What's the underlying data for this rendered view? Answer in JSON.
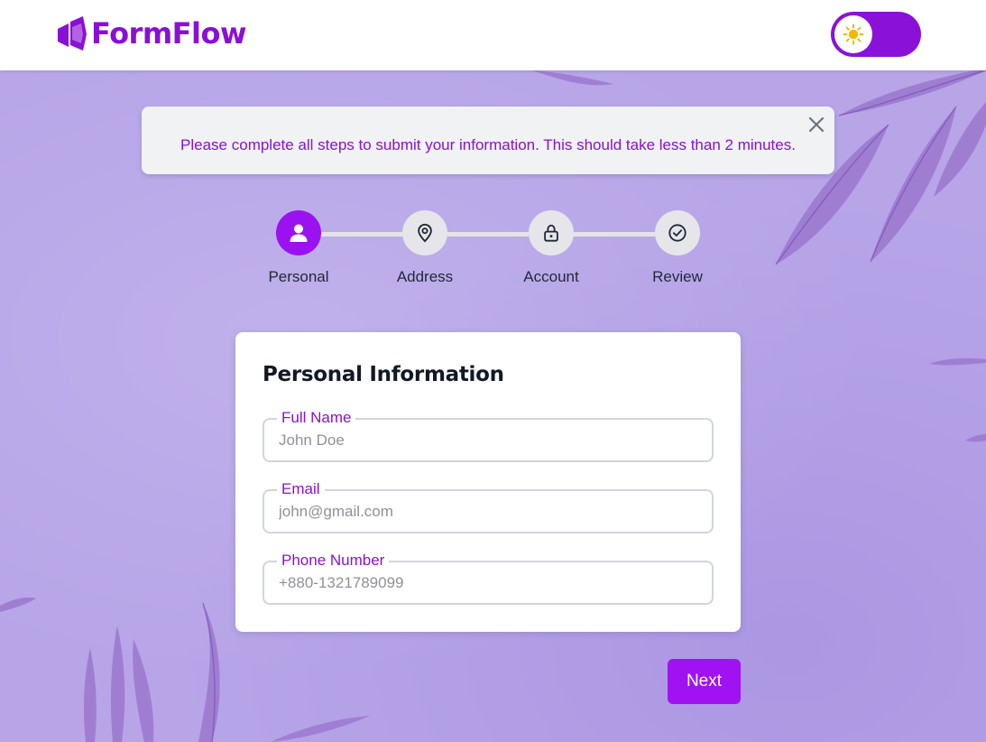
{
  "header": {
    "brand": "FormFlow",
    "theme_toggle": {
      "mode": "light",
      "icon": "sun-icon"
    }
  },
  "alert": {
    "message": "Please complete all steps to submit your information. This should take less than 2 minutes.",
    "close_icon": "close-icon"
  },
  "stepper": {
    "active_index": 0,
    "steps": [
      {
        "label": "Personal",
        "icon": "user-icon"
      },
      {
        "label": "Address",
        "icon": "map-pin-icon"
      },
      {
        "label": "Account",
        "icon": "lock-icon"
      },
      {
        "label": "Review",
        "icon": "check-circle-icon"
      }
    ]
  },
  "form": {
    "title": "Personal Information",
    "fields": [
      {
        "label": "Full Name",
        "placeholder": "John Doe",
        "value": ""
      },
      {
        "label": "Email",
        "placeholder": "john@gmail.com",
        "value": ""
      },
      {
        "label": "Phone Number",
        "placeholder": "+880-1321789099",
        "value": ""
      }
    ]
  },
  "actions": {
    "next_label": "Next"
  },
  "colors": {
    "brand": "#8a0fd6",
    "accent": "#a112f2",
    "background": "#b7a5e8",
    "step_inactive": "#e6e6ea"
  }
}
